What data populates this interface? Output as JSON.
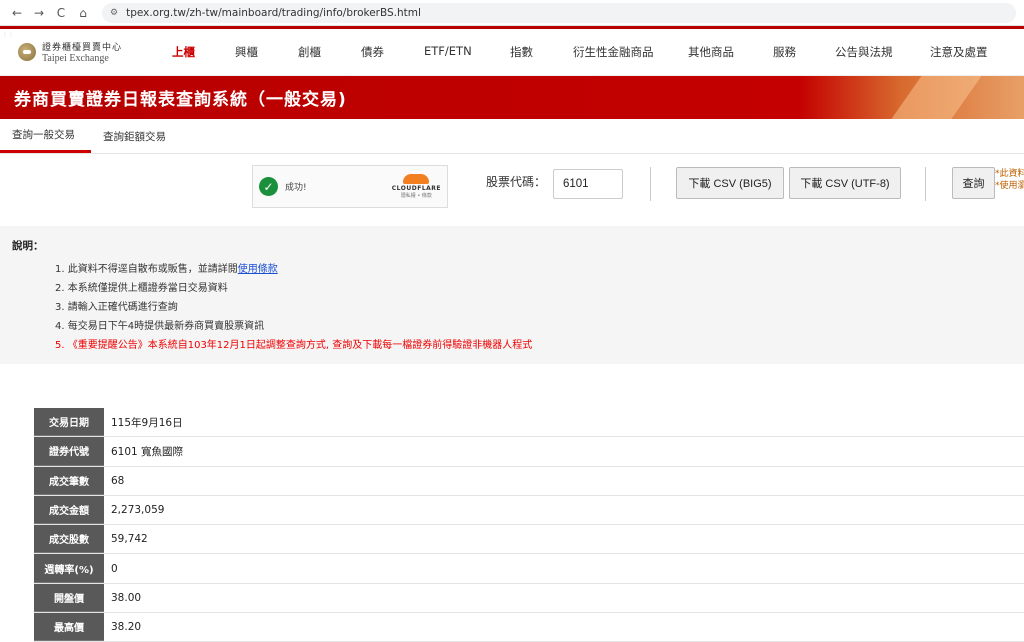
{
  "browser": {
    "url": "tpex.org.tw/zh-tw/mainboard/trading/info/brokerBS.html",
    "back": "←",
    "forward": "→",
    "reload": "C",
    "home": "⌂",
    "site_info": "⚙"
  },
  "header": {
    "logo_zh": "證券櫃檯買賣中心",
    "logo_en": "Taipei Exchange",
    "nav": [
      "上櫃",
      "興櫃",
      "創櫃",
      "債券",
      "ETF/ETN",
      "指數",
      "衍生性金融商品",
      "其他商品",
      "服務",
      "公告與法規",
      "注意及處置"
    ]
  },
  "banner": {
    "title": "券商買賣證券日報表查詢系統（一般交易)"
  },
  "tabs": [
    "查詢一般交易",
    "查詢鉅額交易"
  ],
  "captcha": {
    "status": "成功!",
    "provider": "CLOUDFLARE",
    "links": "隱私權 • 條款"
  },
  "query": {
    "stock_label": "股票代碼：",
    "stock_value": "6101",
    "btn_csv_big5": "下載 CSV (BIG5)",
    "btn_csv_utf8": "下載 CSV (UTF-8)",
    "btn_query": "查詢",
    "note_1": "*此資料",
    "note_2": "*使用瀏"
  },
  "explain": {
    "title": "說明：",
    "item1_text": "1. 此資料不得逕自散布或販售，並請詳閱",
    "item1_link": "使用條款",
    "item2": "2. 本系統僅提供上櫃證券當日交易資料",
    "item3": "3. 請輸入正確代碼進行查詢",
    "item4": "4. 每交易日下午4時提供最新券商買賣股票資訊",
    "item5": "5. 《重要提醒公告》本系統自103年12月1日起調整查詢方式, 查詢及下載每一檔證券前得驗證非機器人程式"
  },
  "table": {
    "rows": [
      {
        "label": "交易日期",
        "value": "115年9月16日"
      },
      {
        "label": "證券代號",
        "value": "6101 寬魚國際"
      },
      {
        "label": "成交筆數",
        "value": "68"
      },
      {
        "label": "成交金額",
        "value": "2,273,059"
      },
      {
        "label": "成交股數",
        "value": "59,742"
      },
      {
        "label": "週轉率(%)",
        "value": "0"
      },
      {
        "label": "開盤價",
        "value": "38.00"
      },
      {
        "label": "最高價",
        "value": "38.20"
      }
    ]
  }
}
